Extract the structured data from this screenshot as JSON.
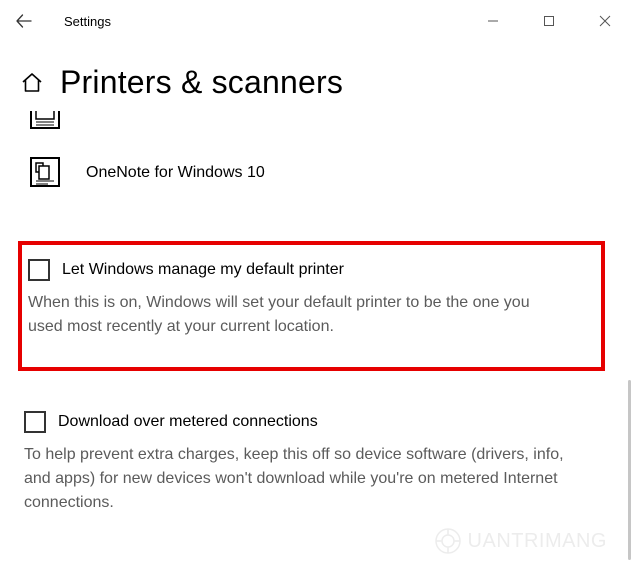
{
  "window": {
    "title": "Settings"
  },
  "page": {
    "title": "Printers & scanners"
  },
  "printers": [
    {
      "name": "OneNote for Windows 10"
    }
  ],
  "options": {
    "default_printer": {
      "label": "Let Windows manage my default printer",
      "description": "When this is on, Windows will set your default printer to be the one you used most recently at your current location.",
      "checked": false
    },
    "metered": {
      "label": "Download over metered connections",
      "description": "To help prevent extra charges, keep this off so device software (drivers, info, and apps) for new devices won't download while you're on metered Internet connections.",
      "checked": false
    }
  },
  "watermark": "UANTRIMANG"
}
